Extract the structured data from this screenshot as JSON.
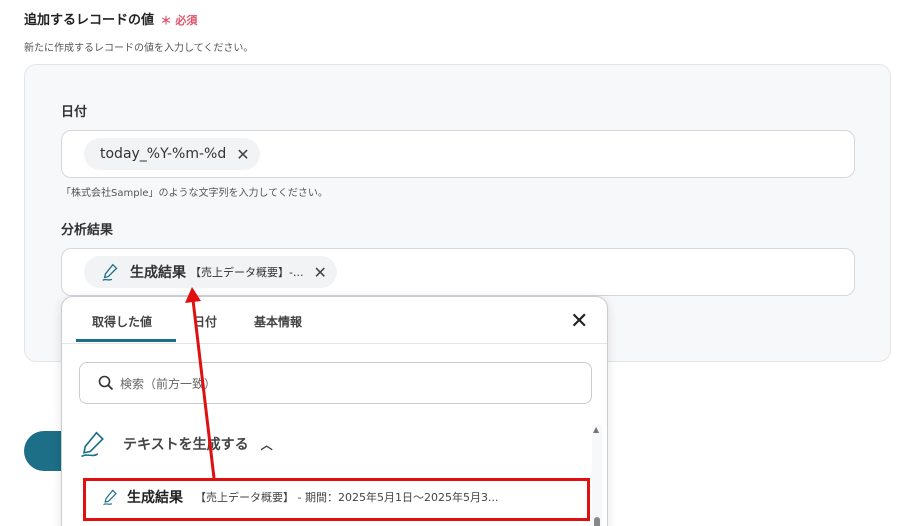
{
  "section": {
    "title": "追加するレコードの値",
    "required": "＊ 必須",
    "description": "新たに作成するレコードの値を入力してください。"
  },
  "fields": {
    "date": {
      "label": "日付",
      "chip": "today_%Y-%m-%d",
      "hint": "「株式会社Sample」のような文字列を入力してください。"
    },
    "analysis": {
      "label": "分析結果",
      "chip_bold": "生成結果",
      "chip_detail": "【売上データ概要】-..."
    }
  },
  "dropdown": {
    "tabs": [
      "取得した値",
      "日付",
      "基本情報"
    ],
    "active_tab": "取得した値",
    "search_placeholder": "検索（前方一致）",
    "group_label": "テキストを生成する",
    "item": {
      "bold": "生成結果",
      "detail": "【売上データ概要】 - 期間：2025年5月1日〜2025年5月3..."
    }
  },
  "icons": {
    "remove": "close-icon",
    "pen": "pen-icon",
    "search": "search-icon",
    "chevron": "chevron-up-icon"
  },
  "colors": {
    "accent": "#1c6f87",
    "required": "#e2536b",
    "highlight": "#e01010"
  }
}
